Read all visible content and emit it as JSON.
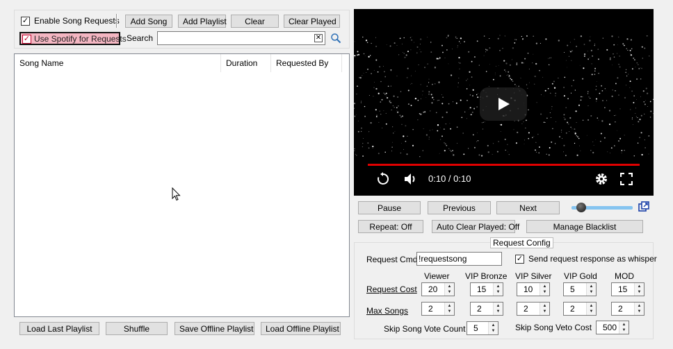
{
  "toolbar": {
    "enable_requests_label": "Enable Song Requests",
    "use_spotify_label": "Use Spotify for Requests",
    "add_song": "Add Song",
    "add_playlist": "Add Playlist",
    "clear": "Clear",
    "clear_played": "Clear Played",
    "search_label": "Search",
    "search_value": ""
  },
  "song_list": {
    "columns": [
      "Song Name",
      "Duration",
      "Requested By"
    ]
  },
  "bottom_buttons": {
    "load_last_playlist": "Load Last Playlist",
    "shuffle": "Shuffle",
    "save_offline_playlist": "Save Offline Playlist",
    "load_offline_playlist": "Load Offline Playlist"
  },
  "video": {
    "time": "0:10 / 0:10",
    "progress": 1.0
  },
  "playback": {
    "pause": "Pause",
    "previous": "Previous",
    "next": "Next",
    "repeat": "Repeat: Off",
    "auto_clear": "Auto Clear Played: Off",
    "manage_blacklist": "Manage Blacklist",
    "volume": 0.08
  },
  "request_config": {
    "title": "Request Config",
    "cmd_label": "Request Cmd:",
    "cmd_value": "!requestsong",
    "whisper_label": "Send request response as whisper",
    "tiers": [
      "Viewer",
      "VIP Bronze",
      "VIP Silver",
      "VIP Gold",
      "MOD"
    ],
    "request_cost_label": "Request Cost",
    "request_cost": [
      "20",
      "15",
      "10",
      "5",
      "15"
    ],
    "max_songs_label": "Max Songs",
    "max_songs": [
      "2",
      "2",
      "2",
      "2",
      "2"
    ],
    "skip_vote_label": "Skip Song Vote Count",
    "skip_vote_value": "5",
    "skip_veto_label": "Skip Song Veto Cost",
    "skip_veto_value": "500"
  },
  "colors": {
    "progress_red": "#e00000",
    "spotify_highlight": "#f4b6c2",
    "slider_blue": "#85c4f0"
  }
}
